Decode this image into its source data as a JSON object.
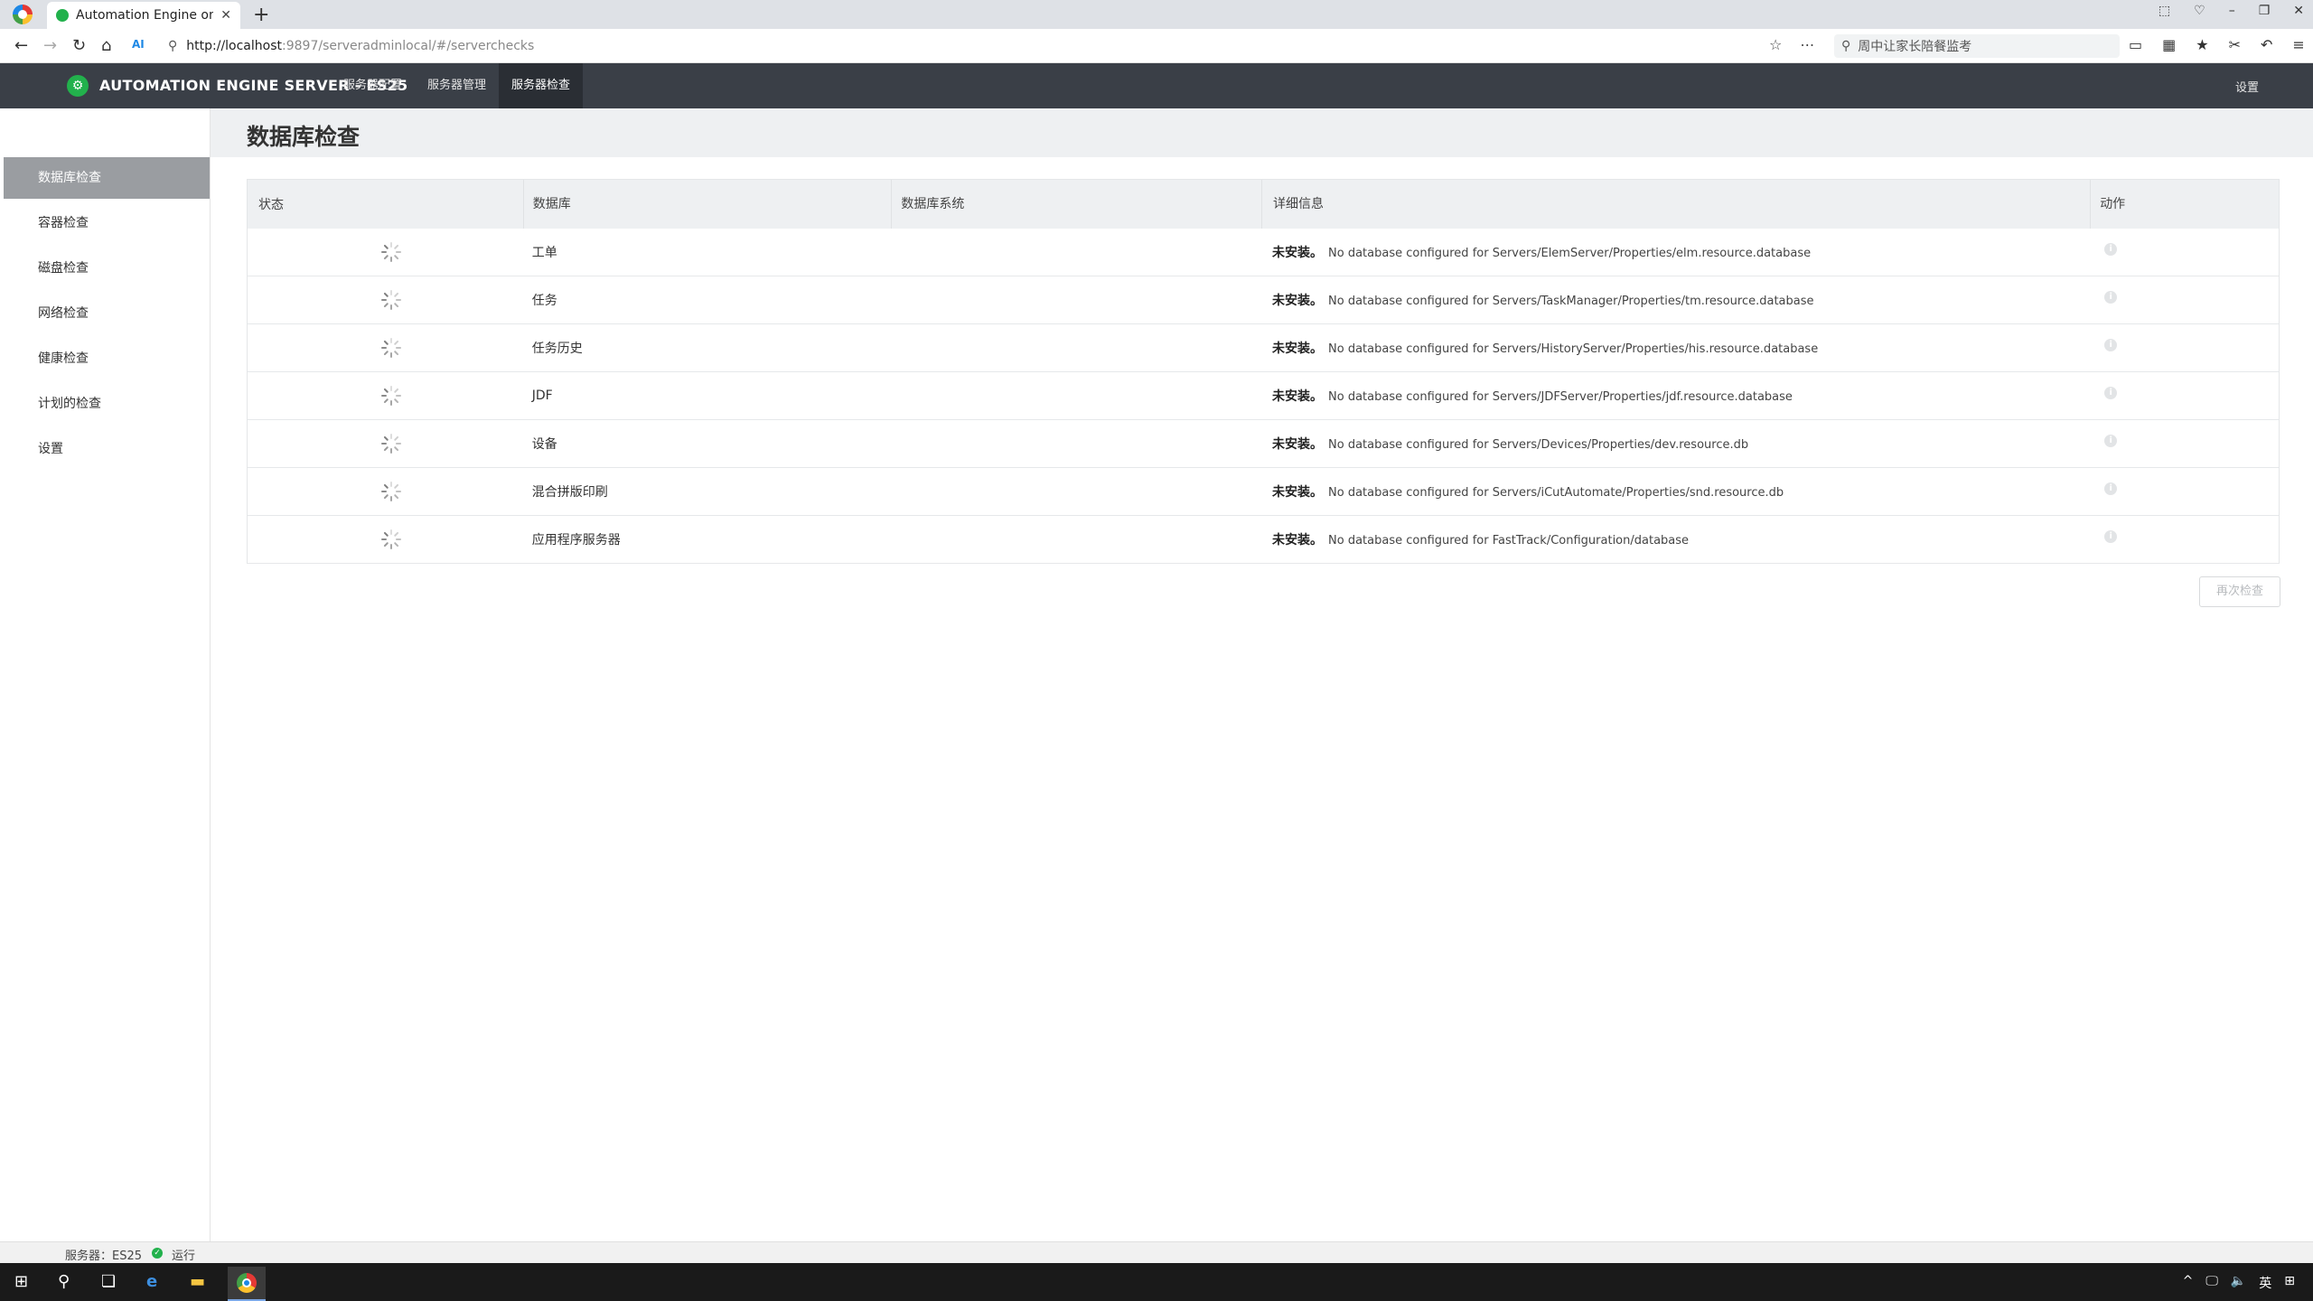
{
  "browser": {
    "tab_title": "Automation Engine on loca",
    "tab_close": "✕",
    "new_tab": "+",
    "url_host": "http://localhost",
    "url_rest": ":9897/serveradminlocal/#/serverchecks",
    "search_placeholder": "周中让家长陪餐监考",
    "window_controls": [
      "⬚",
      "♡",
      "–",
      "❐",
      "✕"
    ]
  },
  "app": {
    "title": "AUTOMATION ENGINE SERVER - ES25",
    "nav": [
      {
        "label": "服务器配置",
        "active": false
      },
      {
        "label": "服务器管理",
        "active": false
      },
      {
        "label": "服务器检查",
        "active": true
      }
    ],
    "settings_label": "设置"
  },
  "sidebar": {
    "items": [
      {
        "label": "数据库检查",
        "active": true
      },
      {
        "label": "容器检查",
        "active": false
      },
      {
        "label": "磁盘检查",
        "active": false
      },
      {
        "label": "网络检查",
        "active": false
      },
      {
        "label": "健康检查",
        "active": false
      },
      {
        "label": "计划的检查",
        "active": false
      },
      {
        "label": "设置",
        "active": false
      }
    ]
  },
  "page": {
    "title": "数据库检查"
  },
  "table": {
    "headers": {
      "status": "状态",
      "database": "数据库",
      "system": "数据库系统",
      "details": "详细信息",
      "action": "动作"
    },
    "rows": [
      {
        "database": "工单",
        "system": "",
        "detail_label": "未安装。",
        "detail_message": "No database configured for Servers/ElemServer/Properties/elm.resource.database"
      },
      {
        "database": "任务",
        "system": "",
        "detail_label": "未安装。",
        "detail_message": "No database configured for Servers/TaskManager/Properties/tm.resource.database"
      },
      {
        "database": "任务历史",
        "system": "",
        "detail_label": "未安装。",
        "detail_message": "No database configured for Servers/HistoryServer/Properties/his.resource.database"
      },
      {
        "database": "JDF",
        "system": "",
        "detail_label": "未安装。",
        "detail_message": "No database configured for Servers/JDFServer/Properties/jdf.resource.database"
      },
      {
        "database": "设备",
        "system": "",
        "detail_label": "未安装。",
        "detail_message": "No database configured for Servers/Devices/Properties/dev.resource.db"
      },
      {
        "database": "混合拼版印刷",
        "system": "",
        "detail_label": "未安装。",
        "detail_message": "No database configured for Servers/iCutAutomate/Properties/snd.resource.db"
      },
      {
        "database": "应用程序服务器",
        "system": "",
        "detail_label": "未安装。",
        "detail_message": "No database configured for FastTrack/Configuration/database"
      }
    ],
    "recheck_label": "再次检查"
  },
  "status_bar": {
    "server_label": "服务器：ES25",
    "state": "运行"
  },
  "taskbar": {
    "tray": [
      "^",
      "🖵",
      "🔈",
      "英",
      "⊞"
    ]
  },
  "colors": {
    "header_bg": "#3a3f47",
    "accent_green": "#22b14c",
    "sidebar_active": "#9a9da1"
  }
}
